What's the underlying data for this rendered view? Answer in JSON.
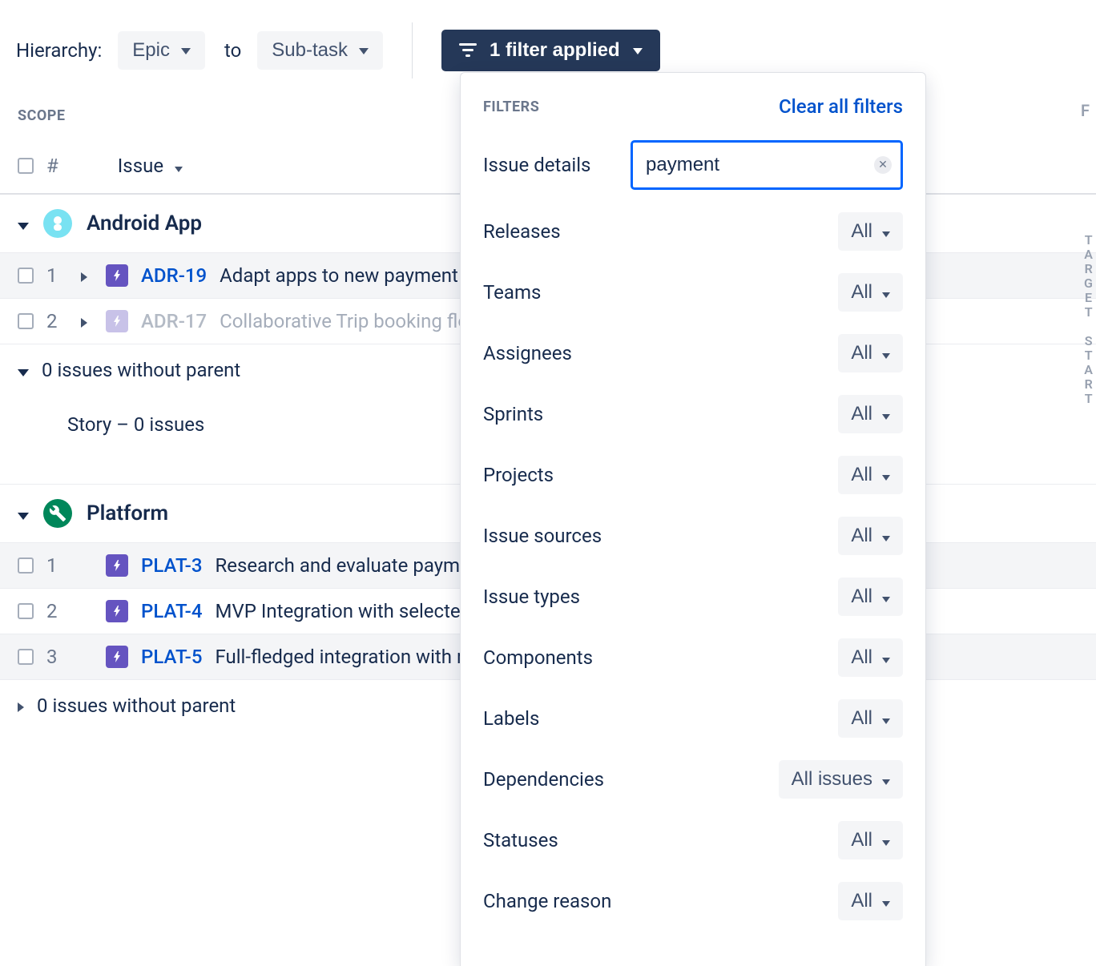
{
  "topbar": {
    "hierarchy_label": "Hierarchy:",
    "from_value": "Epic",
    "to_label": "to",
    "to_value": "Sub-task",
    "filter_button": "1 filter applied"
  },
  "edge": {
    "f": "F",
    "target_start": "TARGET START"
  },
  "scope": {
    "label": "SCOPE",
    "hash": "#",
    "issue_col": "Issue"
  },
  "groups": [
    {
      "name": "Android App",
      "avatar": "android",
      "rows": [
        {
          "num": "1",
          "key": "ADR-19",
          "summary": "Adapt apps to new payment",
          "dim": false,
          "hl": true,
          "expandable": true
        },
        {
          "num": "2",
          "key": "ADR-17",
          "summary": "Collaborative Trip booking flo",
          "dim": true,
          "hl": false,
          "expandable": true
        }
      ],
      "without_parent": "0 issues without parent",
      "empty_story": "Story – 0 issues"
    },
    {
      "name": "Platform",
      "avatar": "platform",
      "rows": [
        {
          "num": "1",
          "key": "PLAT-3",
          "summary": "Research and evaluate payme",
          "dim": false,
          "hl": true,
          "expandable": false
        },
        {
          "num": "2",
          "key": "PLAT-4",
          "summary": "MVP Integration with selected",
          "dim": false,
          "hl": false,
          "expandable": false
        },
        {
          "num": "3",
          "key": "PLAT-5",
          "summary": "Full-fledged integration with r",
          "dim": false,
          "hl": true,
          "expandable": false
        }
      ],
      "without_parent": "0 issues without parent"
    }
  ],
  "panel": {
    "title": "FILTERS",
    "clear": "Clear all filters",
    "issue_details_label": "Issue details",
    "search_value": "payment",
    "filters": [
      {
        "label": "Releases",
        "value": "All"
      },
      {
        "label": "Teams",
        "value": "All"
      },
      {
        "label": "Assignees",
        "value": "All"
      },
      {
        "label": "Sprints",
        "value": "All"
      },
      {
        "label": "Projects",
        "value": "All"
      },
      {
        "label": "Issue sources",
        "value": "All"
      },
      {
        "label": "Issue types",
        "value": "All"
      },
      {
        "label": "Components",
        "value": "All"
      },
      {
        "label": "Labels",
        "value": "All"
      },
      {
        "label": "Dependencies",
        "value": "All issues"
      },
      {
        "label": "Statuses",
        "value": "All"
      },
      {
        "label": "Change reason",
        "value": "All"
      }
    ]
  }
}
